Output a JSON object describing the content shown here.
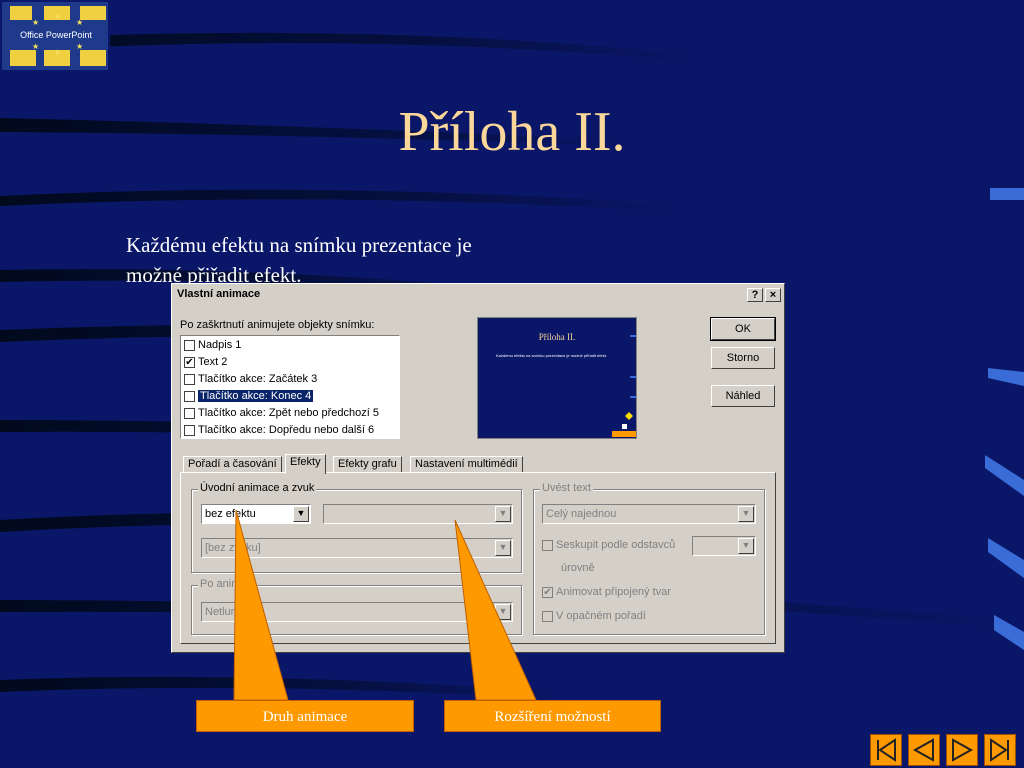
{
  "slide": {
    "title": "Příloha II.",
    "body": "Každému efektu na snímku prezentace je možné přiřadit efekt."
  },
  "logo": {
    "text": "Office PowerPoint"
  },
  "dialog": {
    "title": "Vlastní animace",
    "help_label": "?",
    "close_label": "×",
    "list_label": "Po zaškrtnutí animujete objekty snímku:",
    "items": [
      {
        "label": "Nadpis 1",
        "checked": false
      },
      {
        "label": "Text 2",
        "checked": true
      },
      {
        "label": "Tlačítko akce: Začátek 3",
        "checked": false
      },
      {
        "label": "Tlačítko akce: Konec 4",
        "checked": false,
        "selected": true
      },
      {
        "label": "Tlačítko akce: Zpět nebo předchozí 5",
        "checked": false
      },
      {
        "label": "Tlačítko akce: Dopředu nebo další 6",
        "checked": false
      }
    ],
    "preview": {
      "title": "Příloha II.",
      "text": "Každému efektu na snímku prezentace je možné přiřadit efekt."
    },
    "buttons": {
      "ok": "OK",
      "cancel": "Storno",
      "preview": "Náhled"
    },
    "tabs": [
      "Pořadí a časování",
      "Efekty",
      "Efekty grafu",
      "Nastavení multimédií"
    ],
    "active_tab": "Efekty",
    "entry_group": {
      "label": "Úvodní animace a zvuk",
      "effect_value": "bez efektu",
      "direction_value": "",
      "sound_value": "[bez zvuku]"
    },
    "after_group": {
      "label": "Po animaci",
      "value": "Netlumit"
    },
    "text_group": {
      "label": "Uvést text",
      "text_value": "Celý najednou",
      "group_label": "Seskupit podle odstavců",
      "level_label": "úrovně",
      "animate_shape_label": "Animovat připojený tvar",
      "reverse_label": "V opačném pořadí"
    }
  },
  "callouts": {
    "left": "Druh animace",
    "right": "Rozšíření možností"
  },
  "colors": {
    "background": "#0a1668",
    "title": "#fcd79a",
    "accent": "#ff9900",
    "dialog": "#d4d0c8"
  }
}
